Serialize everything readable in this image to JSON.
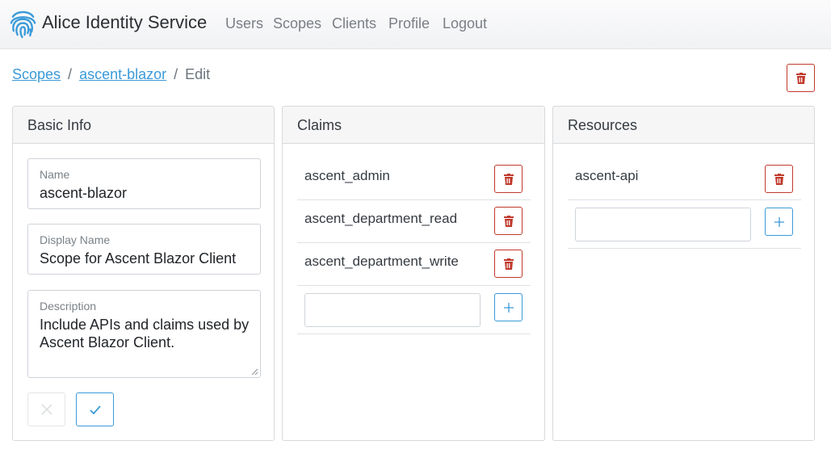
{
  "app": {
    "title": "Alice Identity Service"
  },
  "nav": {
    "users": "Users",
    "scopes": "Scopes",
    "clients": "Clients",
    "profile": "Profile",
    "logout": "Logout"
  },
  "breadcrumb": {
    "root": "Scopes",
    "item": "ascent-blazor",
    "current": "Edit",
    "separator": "/"
  },
  "colors": {
    "primary": "#3a9ad9",
    "danger": "#c0392b",
    "border": "#d7d9dc"
  },
  "basic_info": {
    "header": "Basic Info",
    "name_label": "Name",
    "name_value": "ascent-blazor",
    "display_name_label": "Display Name",
    "display_name_value": "Scope for Ascent Blazor Client",
    "description_label": "Description",
    "description_value": "Include APIs and claims used by Ascent Blazor Client."
  },
  "claims": {
    "header": "Claims",
    "items": [
      "ascent_admin",
      "ascent_department_read",
      "ascent_department_write"
    ]
  },
  "resources": {
    "header": "Resources",
    "items": [
      "ascent-api"
    ]
  },
  "icons": {
    "delete": "trash-icon",
    "add": "plus-icon",
    "cancel": "x-icon",
    "save": "check-icon",
    "logo": "fingerprint-icon"
  }
}
